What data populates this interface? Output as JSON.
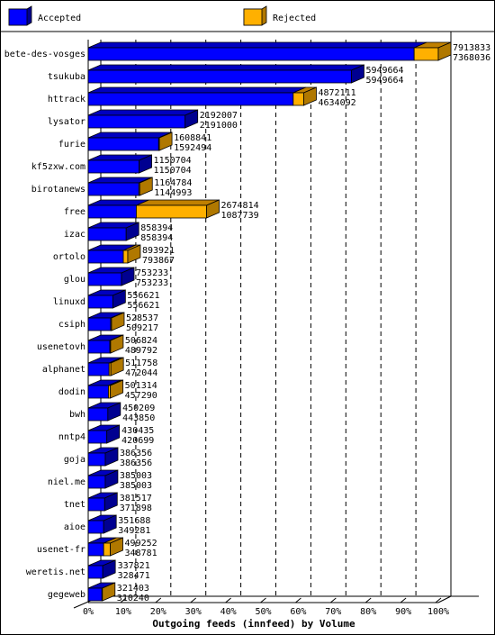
{
  "chart_data": {
    "type": "bar",
    "orientation": "horizontal",
    "style": "3d-stacked",
    "title": "",
    "xlabel": "Outgoing feeds (innfeed) by Volume",
    "ylabel": "",
    "xlim": [
      0,
      100
    ],
    "x_unit": "%",
    "x_ticks": [
      "0%",
      "10%",
      "20%",
      "30%",
      "40%",
      "50%",
      "60%",
      "70%",
      "80%",
      "90%",
      "100%"
    ],
    "grid": "vertical-dashed",
    "legend": {
      "placement": "top",
      "entries": [
        {
          "name": "Accepted",
          "color": "#0000ff"
        },
        {
          "name": "Rejected",
          "color": "#ffb000"
        }
      ]
    },
    "colors": {
      "accepted_front": "#0000ff",
      "accepted_top": "#0000c0",
      "accepted_side": "#000090",
      "rejected_front": "#ffb000",
      "rejected_top": "#c08000",
      "rejected_side": "#b07800"
    },
    "max_value": 7913833,
    "categories": [
      "bete-des-vosges",
      "tsukuba",
      "httrack",
      "lysator",
      "furie",
      "kf5zxw.com",
      "birotanews",
      "free",
      "izac",
      "ortolo",
      "glou",
      "linuxd",
      "csiph",
      "usenetovh",
      "alphanet",
      "dodin",
      "bwh",
      "nntp4",
      "goja",
      "niel.me",
      "tnet",
      "aioe",
      "usenet-fr",
      "weretis.net",
      "gegeweb"
    ],
    "series": [
      {
        "name": "Total",
        "values": [
          7913833,
          5949664,
          4872111,
          2192007,
          1608841,
          1150704,
          1164784,
          2674814,
          858394,
          893921,
          753233,
          556621,
          528537,
          506824,
          511758,
          501314,
          450209,
          430435,
          386356,
          385003,
          381517,
          351688,
          499252,
          337821,
          321403
        ]
      },
      {
        "name": "Accepted",
        "values": [
          7368036,
          5949664,
          4634092,
          2191000,
          1592494,
          1150704,
          1144993,
          1087739,
          858394,
          793867,
          753233,
          556621,
          509217,
          489792,
          472044,
          457290,
          443850,
          420699,
          386356,
          385003,
          371898,
          349281,
          348781,
          328471,
          310240
        ]
      }
    ]
  }
}
